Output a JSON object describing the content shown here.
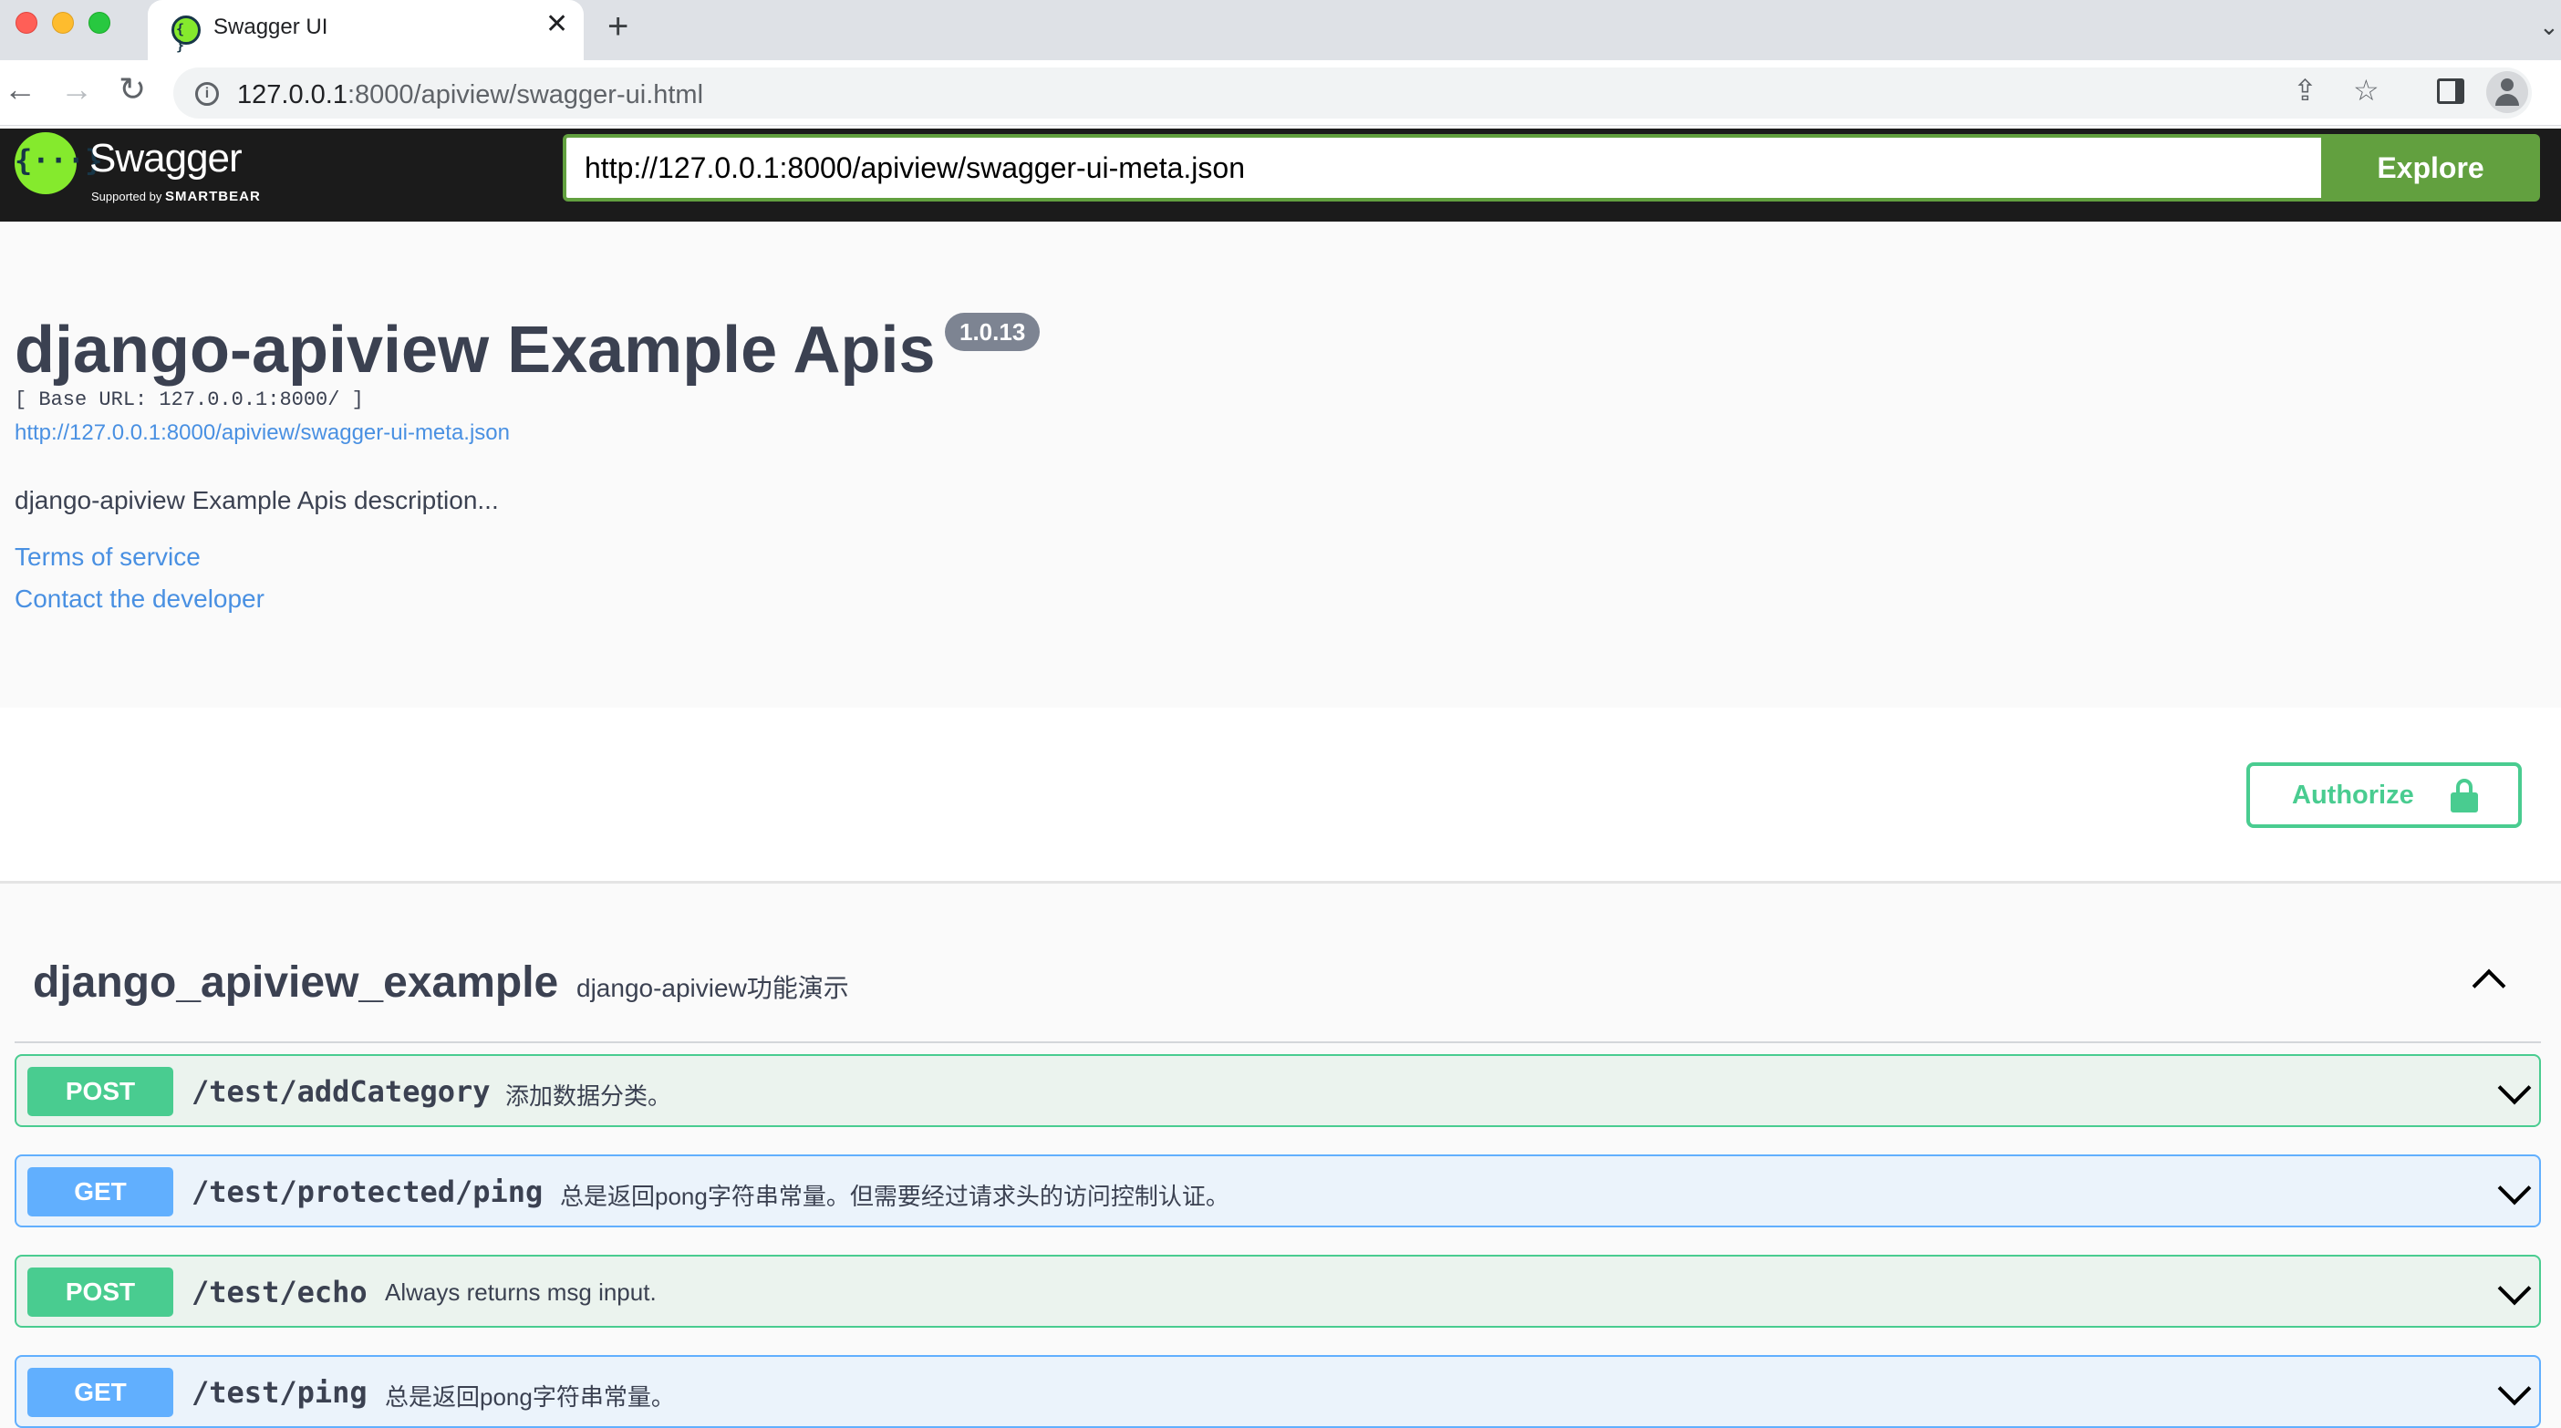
{
  "browser": {
    "tab_title": "Swagger UI",
    "close_glyph": "✕",
    "newtab_glyph": "+",
    "tabs_chevron_glyph": "⌄",
    "back_glyph": "←",
    "forward_glyph": "→",
    "reload_glyph": "↻",
    "info_glyph": "i",
    "url_host": "127.0.0.1",
    "url_rest": ":8000/apiview/swagger-ui.html",
    "share_glyph": "⇪",
    "star_glyph": "☆",
    "icons": [
      "close-icon",
      "add-tab-icon",
      "back-icon",
      "forward-icon",
      "reload-icon",
      "info-icon",
      "share-icon",
      "star-icon",
      "side-panel-icon",
      "profile-icon"
    ]
  },
  "topbar": {
    "logo_glyph": "{···}",
    "logo_word": "Swagger",
    "logo_supported": "Supported by",
    "logo_brand": "SMARTBEAR",
    "spec_url": "http://127.0.0.1:8000/apiview/swagger-ui-meta.json",
    "explore_label": "Explore",
    "colors": {
      "background": "#1b1b1b",
      "accent": "#62a03f",
      "logo": "#85ea2d"
    }
  },
  "info": {
    "title": "django-apiview Example Apis",
    "version": "1.0.13",
    "base_url": "[ Base URL: 127.0.0.1:8000/ ]",
    "spec_link": "http://127.0.0.1:8000/apiview/swagger-ui-meta.json",
    "description": "django-apiview Example Apis description...",
    "terms_label": "Terms of service",
    "contact_label": "Contact the developer"
  },
  "schemes": {
    "authorize_label": "Authorize",
    "authorize_icon": "unlocked-lock-icon"
  },
  "tag": {
    "name": "django_apiview_example",
    "description": "django-apiview功能演示",
    "expanded": true
  },
  "operations": [
    {
      "method": "POST",
      "path": "/test/addCategory",
      "summary": "添加数据分类。"
    },
    {
      "method": "GET",
      "path": "/test/protected/ping",
      "summary": "总是返回pong字符串常量。但需要经过请求头的访问控制认证。"
    },
    {
      "method": "POST",
      "path": "/test/echo",
      "summary": "Always returns msg input."
    },
    {
      "method": "GET",
      "path": "/test/ping",
      "summary": "总是返回pong字符串常量。"
    }
  ],
  "method_colors": {
    "POST": "#49cc90",
    "GET": "#61affe"
  }
}
